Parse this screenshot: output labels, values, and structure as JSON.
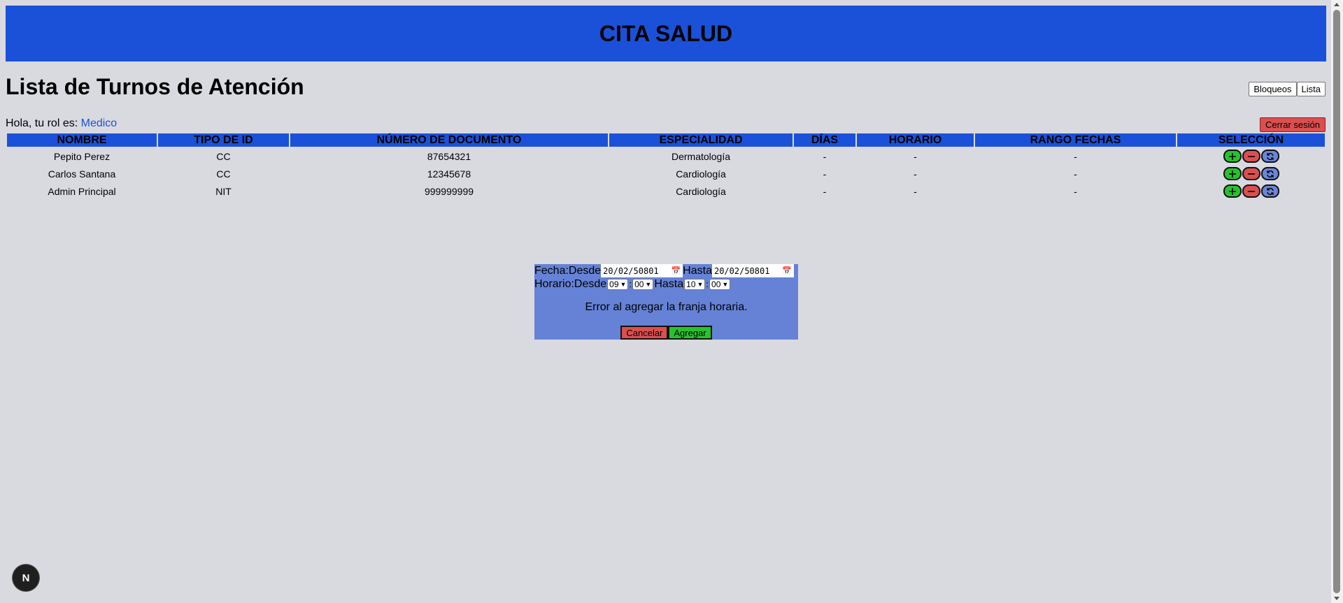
{
  "header": {
    "title": "CITA SALUD"
  },
  "page": {
    "title": "Lista de Turnos de Atención"
  },
  "view_switch": {
    "bloqueos_label": "Bloqueos",
    "lista_label": "Lista"
  },
  "user": {
    "greeting": "Hola, tu rol es:",
    "role": "Medico",
    "logout_label": "Cerrar sesión"
  },
  "table": {
    "headers": [
      "NOMBRE",
      "TIPO DE ID",
      "NÚMERO DE DOCUMENTO",
      "ESPECIALIDAD",
      "DÍAS",
      "HORARIO",
      "RANGO FECHAS",
      "SELECCIÓN"
    ],
    "rows": [
      {
        "nombre": "Pepito Perez",
        "tipo_id": "CC",
        "documento": "87654321",
        "especialidad": "Dermatología",
        "dias": "-",
        "horario": "-",
        "rango": "-"
      },
      {
        "nombre": "Carlos Santana",
        "tipo_id": "CC",
        "documento": "12345678",
        "especialidad": "Cardiología",
        "dias": "-",
        "horario": "-",
        "rango": "-"
      },
      {
        "nombre": "Admin Principal",
        "tipo_id": "NIT",
        "documento": "999999999",
        "especialidad": "Cardiología",
        "dias": "-",
        "horario": "-",
        "rango": "-"
      }
    ],
    "action_icons": [
      "plus-icon",
      "minus-icon",
      "refresh-icon"
    ]
  },
  "modal": {
    "fecha_label": "Fecha:",
    "desde_label": "Desde",
    "hasta_label": "Hasta",
    "fecha_desde": "20/02/50801",
    "fecha_hasta": "20/02/50801",
    "horario_label": "Horario:",
    "hora_desde": "09",
    "min_desde": "00",
    "hora_hasta": "10",
    "min_hasta": "00",
    "error_message": "Error al agregar la franja horaria.",
    "cancel_label": "Cancelar",
    "add_label": "Agregar"
  },
  "badge": {
    "letter": "N"
  },
  "colors": {
    "primary": "#1b51d9",
    "background": "#d9dae0",
    "modal_bg": "#6582d6",
    "danger": "#dc4f4f",
    "success": "#25c42b"
  }
}
